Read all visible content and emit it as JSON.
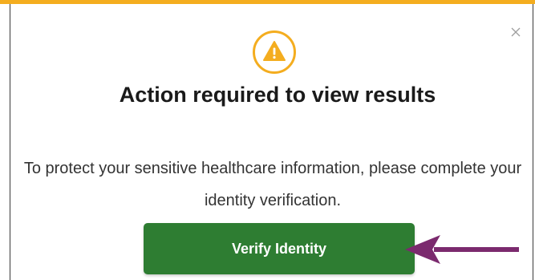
{
  "dialog": {
    "title": "Action required to view results",
    "message": "To protect your sensitive healthcare information, please complete your identity verification.",
    "verify_button_label": "Verify Identity",
    "close_icon": "close-icon",
    "warning_icon": "warning-icon",
    "annotation_icon": "arrow-left-icon"
  },
  "colors": {
    "accent": "#f4ad1f",
    "primary_button": "#2e7d32",
    "annotation_arrow": "#7b2a6e"
  }
}
